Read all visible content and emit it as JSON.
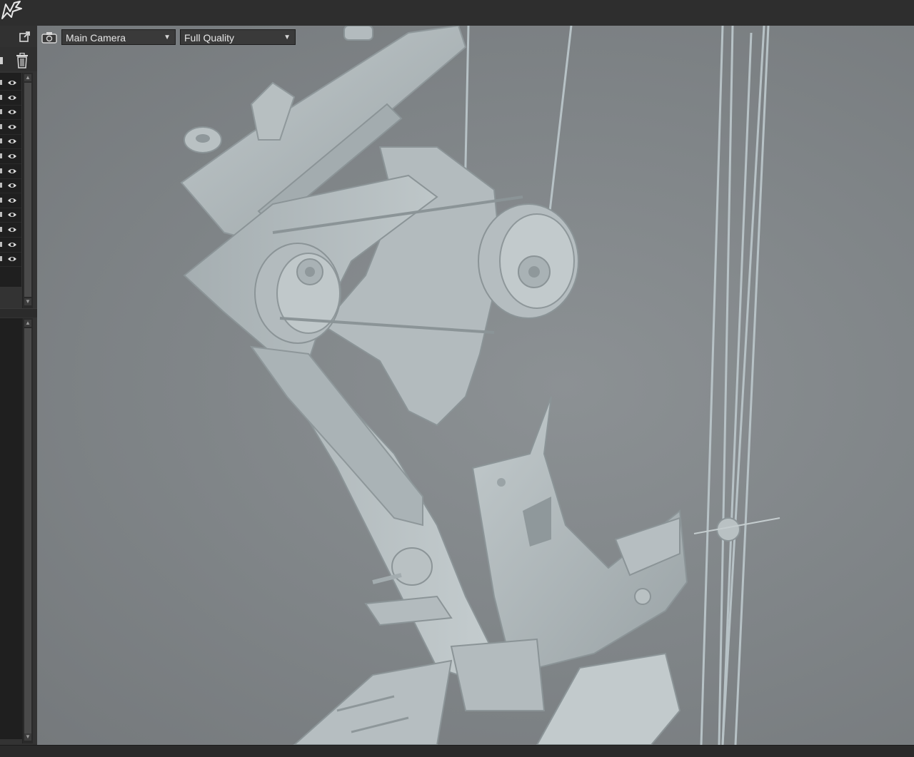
{
  "viewport": {
    "camera_dropdown": {
      "selected": "Main Camera"
    },
    "quality_dropdown": {
      "selected": "Full Quality"
    }
  },
  "icons": {
    "app_logo": "app-logo-icon",
    "popout": "popout-icon",
    "trash": "trash-icon",
    "visibility": "eye-icon",
    "camera": "camera-icon"
  },
  "layers": {
    "row_count": 13
  },
  "colors": {
    "background": "#2b2b2b",
    "panel": "#333333",
    "viewport": "#84888b",
    "model": "#aeb6b8"
  }
}
